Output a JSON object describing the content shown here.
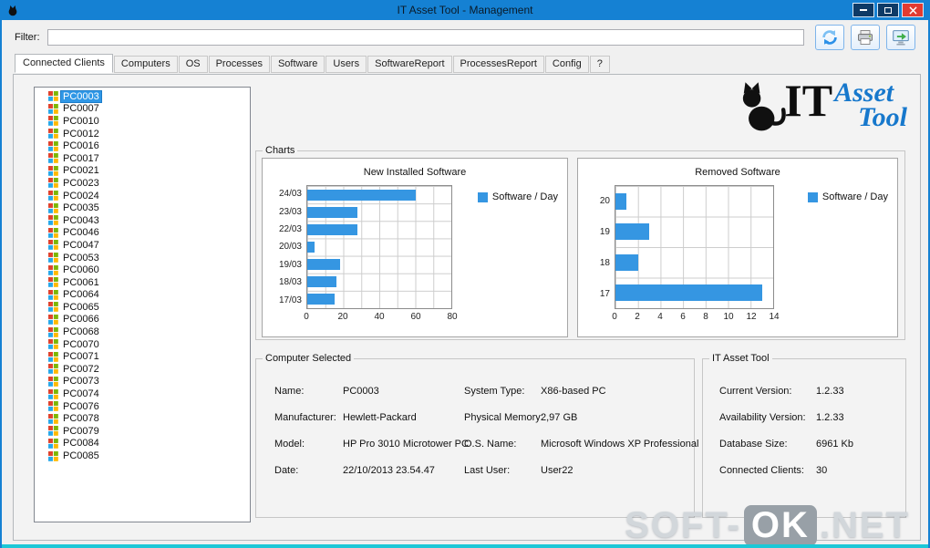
{
  "window": {
    "title": "IT Asset Tool - Management"
  },
  "toolbar": {
    "filter_label": "Filter:",
    "filter_value": "",
    "buttons": [
      {
        "name": "refresh",
        "icon": "refresh-icon"
      },
      {
        "name": "print",
        "icon": "printer-icon"
      },
      {
        "name": "export",
        "icon": "export-icon"
      }
    ]
  },
  "tabs": [
    "Connected Clients",
    "Computers",
    "OS",
    "Processes",
    "Software",
    "Users",
    "SoftwareReport",
    "ProcessesReport",
    "Config",
    "?"
  ],
  "selected_tab": "Connected Clients",
  "tree": {
    "selected": "PC0003",
    "items": [
      "PC0003",
      "PC0007",
      "PC0010",
      "PC0012",
      "PC0016",
      "PC0017",
      "PC0021",
      "PC0023",
      "PC0024",
      "PC0035",
      "PC0043",
      "PC0046",
      "PC0047",
      "PC0053",
      "PC0060",
      "PC0061",
      "PC0064",
      "PC0065",
      "PC0066",
      "PC0068",
      "PC0070",
      "PC0071",
      "PC0072",
      "PC0073",
      "PC0074",
      "PC0076",
      "PC0078",
      "PC0079",
      "PC0084",
      "PC0085"
    ]
  },
  "logo": {
    "it": "IT",
    "asset": "Asset",
    "tool": "Tool"
  },
  "charts_group": {
    "label": "Charts"
  },
  "chart_data": [
    {
      "type": "bar",
      "orientation": "horizontal",
      "title": "New Installed Software",
      "legend": "Software / Day",
      "legend_position": "right",
      "categories": [
        "24/03",
        "23/03",
        "22/03",
        "20/03",
        "19/03",
        "18/03",
        "17/03"
      ],
      "values": [
        60,
        28,
        28,
        4,
        18,
        16,
        15
      ],
      "xlabel": "",
      "ylabel": "",
      "xlim": [
        0,
        80
      ],
      "xticks": [
        0,
        20,
        40,
        60,
        80
      ],
      "x_grid_step": 10,
      "grid": true
    },
    {
      "type": "bar",
      "orientation": "horizontal",
      "title": "Removed Software",
      "legend": "Software / Day",
      "legend_position": "right",
      "categories": [
        "20",
        "19",
        "18",
        "17"
      ],
      "values": [
        1,
        3,
        2,
        13
      ],
      "xlabel": "",
      "ylabel": "",
      "xlim": [
        0,
        14
      ],
      "xticks": [
        0,
        2,
        4,
        6,
        8,
        10,
        12,
        14
      ],
      "x_grid_step": 2,
      "grid": true
    }
  ],
  "computer_selected": {
    "label": "Computer Selected",
    "columns": [
      [
        {
          "label": "Name:",
          "value": "PC0003"
        },
        {
          "label": "Manufacturer:",
          "value": "Hewlett-Packard"
        },
        {
          "label": "Model:",
          "value": "HP Pro 3010 Microtower PC"
        },
        {
          "label": "Date:",
          "value": "22/10/2013 23.54.47"
        }
      ],
      [
        {
          "label": "System Type:",
          "value": "X86-based PC"
        },
        {
          "label": "Physical Memory:",
          "value": "2,97 GB"
        },
        {
          "label": "O.S. Name:",
          "value": "Microsoft Windows XP Professional"
        },
        {
          "label": "Last User:",
          "value": "User22"
        }
      ]
    ]
  },
  "it_asset_tool": {
    "label": "IT Asset Tool",
    "fields": [
      {
        "label": "Current Version:",
        "value": "1.2.33"
      },
      {
        "label": "Availability Version:",
        "value": "1.2.33"
      },
      {
        "label": "Database Size:",
        "value": "6961 Kb"
      },
      {
        "label": "Connected Clients:",
        "value": "30"
      }
    ]
  },
  "watermark": {
    "pre": "SOFT-",
    "ok": "OK",
    "post": ".NET"
  },
  "colors": {
    "titlebar_blue": "#1581d3",
    "bar_blue": "#3596e2",
    "close_red": "#e23b31",
    "selection_blue": "#2f97e6",
    "teal_strip": "#1cc8d7"
  }
}
